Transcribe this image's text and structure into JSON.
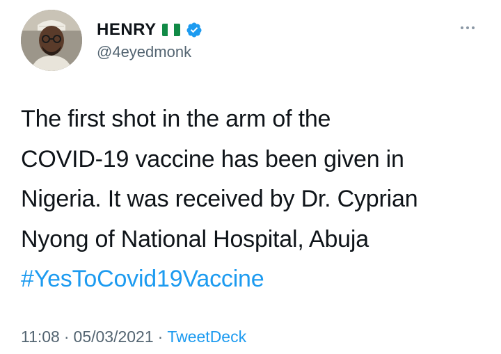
{
  "author": {
    "name": "HENRY",
    "handle": "@4eyedmonk",
    "flag_icon": "nigeria-flag-icon",
    "verified_icon": "verified-badge-icon"
  },
  "tweet": {
    "lines": [
      "The first shot in the arm of the",
      "COVID-19 vaccine has been given in",
      "Nigeria. It was received by Dr. Cyprian",
      "Nyong of National Hospital, Abuja"
    ],
    "hashtag": "#YesToCovid19Vaccine"
  },
  "meta": {
    "time": "11:08",
    "separator1": "·",
    "date": "05/03/2021",
    "separator2": "·",
    "source": "TweetDeck"
  },
  "colors": {
    "accent": "#1d9bf0",
    "secondary_text": "#536471",
    "primary_text": "#0f1419",
    "flag_green": "#118a46"
  }
}
